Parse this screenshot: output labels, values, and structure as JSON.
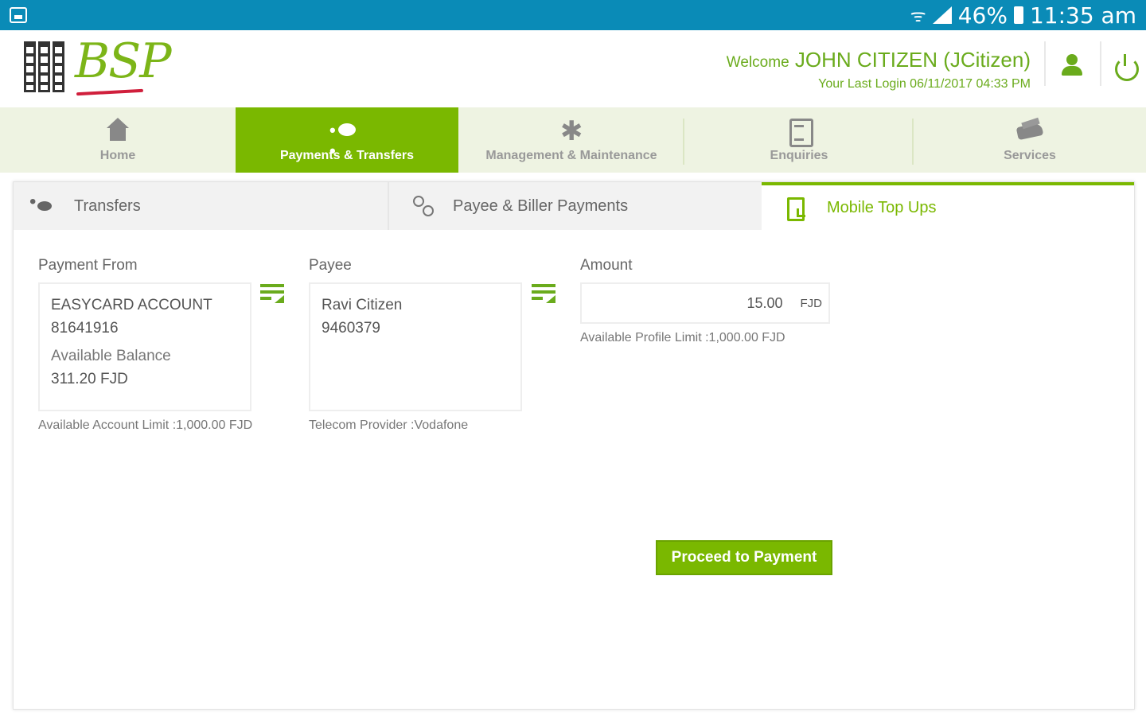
{
  "status_bar": {
    "battery": "46%",
    "time": "11:35 am"
  },
  "header": {
    "logo_text": "BSP",
    "welcome_prefix": "Welcome",
    "user_name": "JOHN CITIZEN (JCitizen)",
    "last_login": "Your Last Login 06/11/2017 04:33 PM"
  },
  "nav": {
    "items": [
      {
        "label": "Home",
        "icon": "home-icon"
      },
      {
        "label": "Payments & Transfers",
        "icon": "money-icon"
      },
      {
        "label": "Management & Maintenance",
        "icon": "tools-icon"
      },
      {
        "label": "Enquiries",
        "icon": "clipboard-icon"
      },
      {
        "label": "Services",
        "icon": "hand-icon"
      }
    ],
    "active": "Payments & Transfers"
  },
  "subtabs": {
    "items": [
      {
        "label": "Transfers",
        "icon": "money-icon"
      },
      {
        "label": "Payee & Biller Payments",
        "icon": "people-icon"
      },
      {
        "label": "Mobile Top Ups",
        "icon": "phone-icon"
      }
    ],
    "active": "Mobile Top Ups"
  },
  "form": {
    "payment_from": {
      "label": "Payment From",
      "account_name": "EASYCARD ACCOUNT",
      "account_number": "81641916",
      "balance_label": "Available Balance",
      "balance_value": "311.20 FJD",
      "note": "Available Account Limit :1,000.00 FJD"
    },
    "payee": {
      "label": "Payee",
      "name": "Ravi Citizen",
      "number": "9460379",
      "note": "Telecom Provider :Vodafone"
    },
    "amount": {
      "label": "Amount",
      "value": "15.00",
      "currency": "FJD",
      "note": "Available Profile Limit :1,000.00 FJD"
    }
  },
  "actions": {
    "proceed_label": "Proceed to Payment"
  }
}
